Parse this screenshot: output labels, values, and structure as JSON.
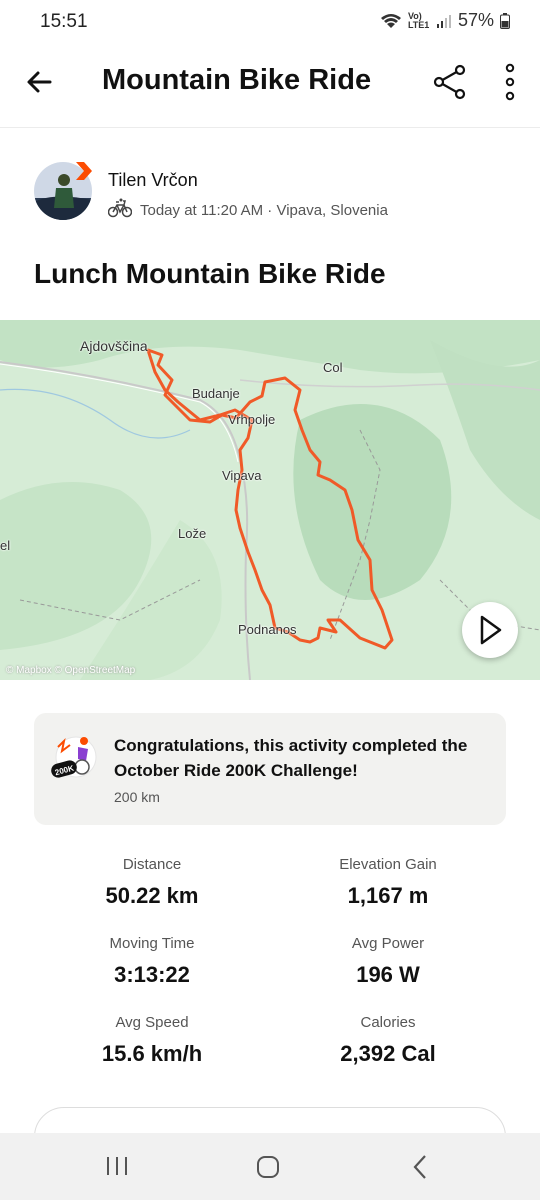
{
  "status_bar": {
    "time": "15:51",
    "network_label": "Vo) LTE1",
    "battery": "57%",
    "icons": [
      "wifi-icon",
      "signal-icon",
      "battery-icon"
    ]
  },
  "app_bar": {
    "title": "Mountain Bike Ride",
    "icons": [
      "back-arrow-icon",
      "share-icon",
      "more-vertical-icon"
    ]
  },
  "athlete": {
    "name": "Tilen Vrčon",
    "meta": "Today at 11:20 AM · Vipava, Slovenia",
    "activity_icon": "mountain-bike-icon"
  },
  "activity_title": "Lunch Mountain Bike Ride",
  "map": {
    "labels": {
      "ajdovscina": "Ajdovščina",
      "col": "Col",
      "budanje": "Budanje",
      "vrhpolje": "Vrhpolje",
      "vipava": "Vipava",
      "loze": "Lože",
      "podnanos": "Podnanos",
      "edge": "el"
    },
    "attribution": "© Mapbox © OpenStreetMap",
    "route_color": "#f05a28",
    "play_icon": "play-icon"
  },
  "challenge": {
    "text": "Congratulations, this activity completed the October Ride 200K Challenge!",
    "subtext": "200 km",
    "badge_label": "200K",
    "badge_icon": "challenge-badge-icon"
  },
  "stats": [
    {
      "label": "Distance",
      "value": "50.22 km"
    },
    {
      "label": "Elevation Gain",
      "value": "1,167 m"
    },
    {
      "label": "Moving Time",
      "value": "3:13:22"
    },
    {
      "label": "Avg Power",
      "value": "196 W"
    },
    {
      "label": "Avg Speed",
      "value": "15.6 km/h"
    },
    {
      "label": "Calories",
      "value": "2,392 Cal"
    }
  ],
  "nav_bar": {
    "icons": [
      "recents-icon",
      "home-icon",
      "back-icon"
    ]
  },
  "colors": {
    "accent": "#fc4c02",
    "route": "#f05a28",
    "map_bg": "#d8eed9"
  }
}
